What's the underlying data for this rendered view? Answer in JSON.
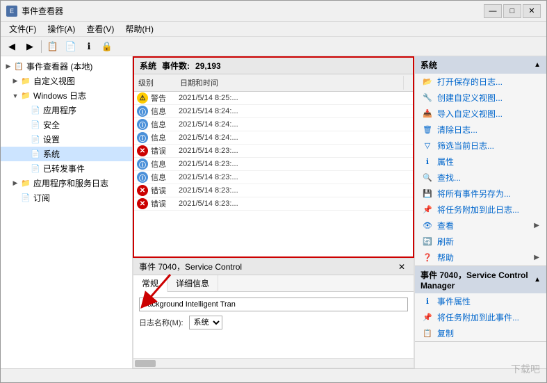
{
  "window": {
    "title": "事件查看器"
  },
  "menubar": {
    "items": [
      "文件(F)",
      "操作(A)",
      "查看(V)",
      "帮助(H)"
    ]
  },
  "sidebar": {
    "items": [
      {
        "label": "事件查看器 (本地)",
        "indent": 0,
        "expand": "▶",
        "icon": "📋"
      },
      {
        "label": "自定义视图",
        "indent": 1,
        "expand": "▶",
        "icon": "📁"
      },
      {
        "label": "Windows 日志",
        "indent": 1,
        "expand": "▼",
        "icon": "📁"
      },
      {
        "label": "应用程序",
        "indent": 2,
        "expand": "",
        "icon": "📄"
      },
      {
        "label": "安全",
        "indent": 2,
        "expand": "",
        "icon": "📄"
      },
      {
        "label": "设置",
        "indent": 2,
        "expand": "",
        "icon": "📄"
      },
      {
        "label": "系统",
        "indent": 2,
        "expand": "",
        "icon": "📄",
        "selected": true
      },
      {
        "label": "已转发事件",
        "indent": 2,
        "expand": "",
        "icon": "📄"
      },
      {
        "label": "应用程序和服务日志",
        "indent": 1,
        "expand": "▶",
        "icon": "📁"
      },
      {
        "label": "订阅",
        "indent": 1,
        "expand": "",
        "icon": "📄"
      }
    ]
  },
  "event_panel": {
    "title": "系统",
    "event_count_label": "事件数:",
    "event_count": "29,193",
    "columns": [
      "级别",
      "日期和时间"
    ],
    "rows": [
      {
        "level_type": "warning",
        "level_text": "警告",
        "datetime": "2021/5/14 8:25:..."
      },
      {
        "level_type": "info",
        "level_text": "信息",
        "datetime": "2021/5/14 8:24:..."
      },
      {
        "level_type": "info",
        "level_text": "信息",
        "datetime": "2021/5/14 8:24:..."
      },
      {
        "level_type": "info",
        "level_text": "信息",
        "datetime": "2021/5/14 8:24:..."
      },
      {
        "level_type": "error",
        "level_text": "错误",
        "datetime": "2021/5/14 8:23:..."
      },
      {
        "level_type": "info",
        "level_text": "信息",
        "datetime": "2021/5/14 8:23:..."
      },
      {
        "level_type": "info",
        "level_text": "信息",
        "datetime": "2021/5/14 8:23:..."
      },
      {
        "level_type": "error",
        "level_text": "错误",
        "datetime": "2021/5/14 8:23:..."
      },
      {
        "level_type": "error",
        "level_text": "错误",
        "datetime": "2021/5/14 8:23:..."
      }
    ]
  },
  "detail_panel": {
    "title": "事件 7040，Service Control",
    "tab_general": "常规",
    "tab_detail": "详细信息",
    "service_name": "Background Intelligent Tran",
    "log_label": "日志名称(M):",
    "log_value": "系统"
  },
  "right_panel": {
    "sections": [
      {
        "title": "系统",
        "actions": [
          {
            "icon": "📂",
            "label": "打开保存的日志...",
            "has_arrow": false
          },
          {
            "icon": "🔧",
            "label": "创建自定义视图...",
            "has_arrow": false
          },
          {
            "icon": "📥",
            "label": "导入自定义视图...",
            "has_arrow": false
          },
          {
            "icon": "🗑",
            "label": "清除日志...",
            "has_arrow": false
          },
          {
            "icon": "▽",
            "label": "筛选当前日志...",
            "has_arrow": false
          },
          {
            "icon": "ℹ",
            "label": "属性",
            "has_arrow": false
          },
          {
            "icon": "🔍",
            "label": "查找...",
            "has_arrow": false
          },
          {
            "icon": "💾",
            "label": "将所有事件另存为...",
            "has_arrow": false
          },
          {
            "icon": "📌",
            "label": "将任务附加到此日志...",
            "has_arrow": false
          },
          {
            "icon": "👁",
            "label": "查看",
            "has_arrow": true
          },
          {
            "icon": "🔄",
            "label": "刷新",
            "has_arrow": false
          },
          {
            "icon": "❓",
            "label": "帮助",
            "has_arrow": true
          }
        ]
      },
      {
        "title": "事件 7040，Service Control Manager",
        "actions": [
          {
            "icon": "ℹ",
            "label": "事件属性",
            "has_arrow": false
          },
          {
            "icon": "📌",
            "label": "将任务附加到此事件...",
            "has_arrow": false
          },
          {
            "icon": "📋",
            "label": "复制",
            "has_arrow": false
          }
        ]
      }
    ]
  },
  "colors": {
    "accent_blue": "#0066cc",
    "header_bg": "#d0d8e4",
    "red_border": "#cc0000",
    "selected_bg": "#cce4ff"
  }
}
